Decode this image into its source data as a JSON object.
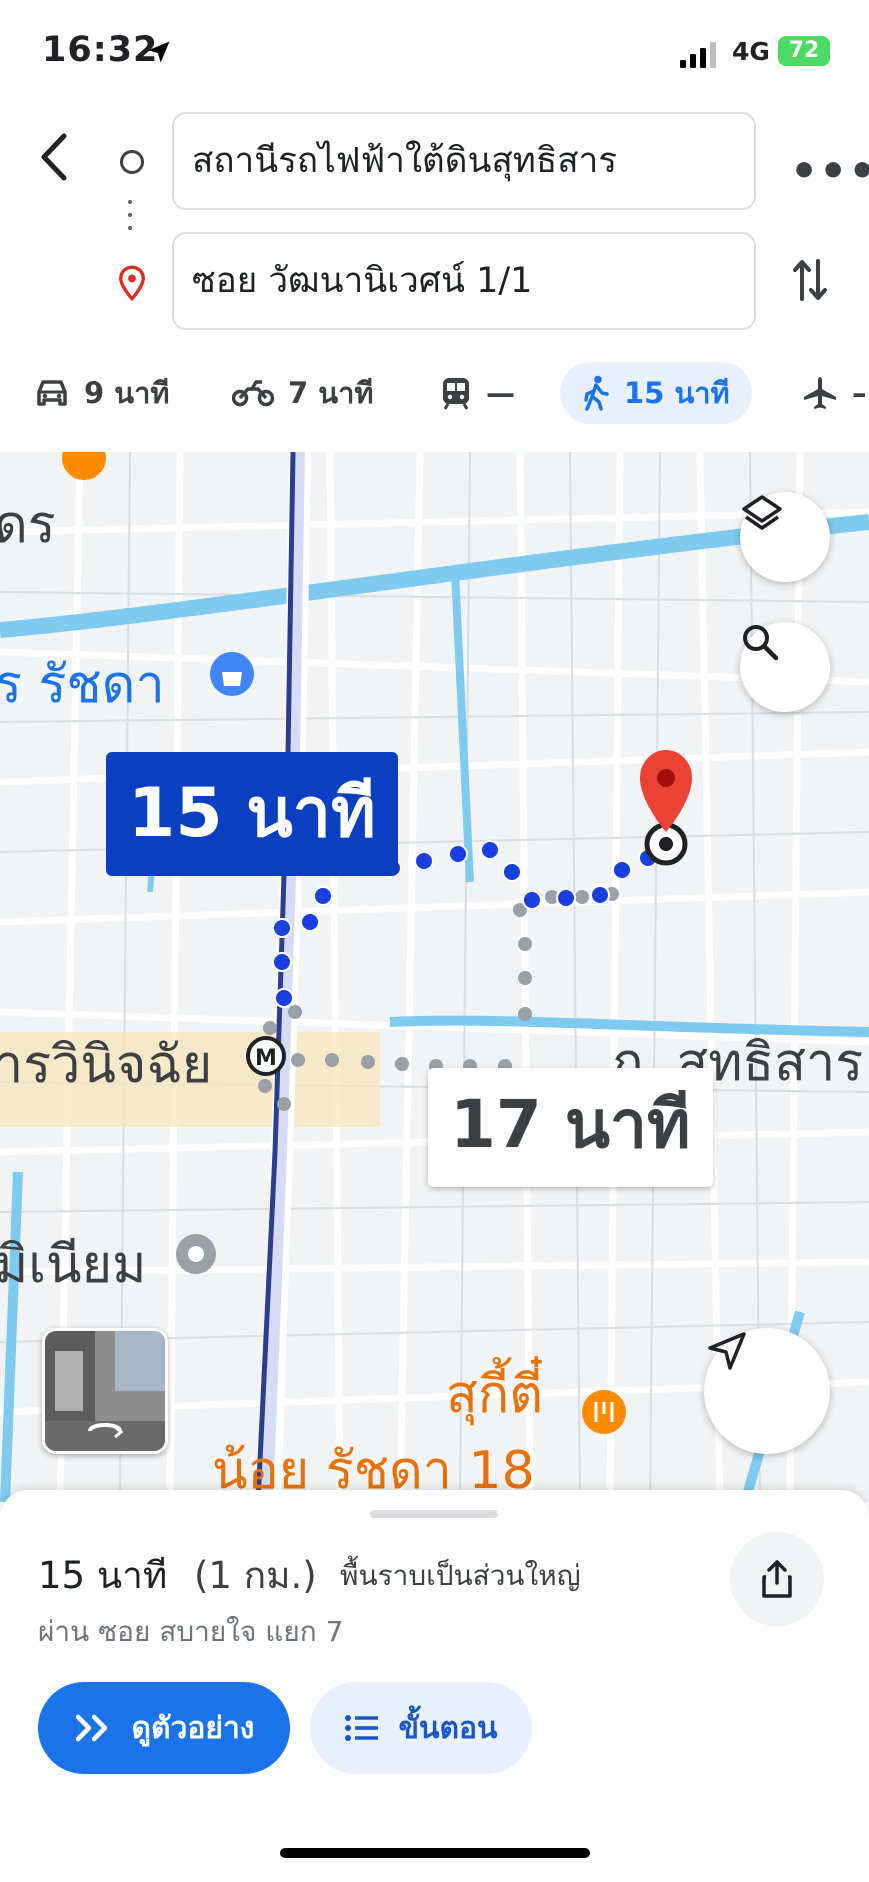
{
  "status_bar": {
    "time": "16:32",
    "network": "4G",
    "battery": "72"
  },
  "search": {
    "origin": "สถานีรถไฟฟ้าใต้ดินสุทธิสาร",
    "destination": "ซอย วัฒนานิเวศน์ 1/1",
    "more": "•••"
  },
  "modes": [
    {
      "icon": "car-icon",
      "label": "9 นาที"
    },
    {
      "icon": "motorcycle-icon",
      "label": "7 นาที"
    },
    {
      "icon": "transit-icon",
      "label": "—"
    },
    {
      "icon": "walk-icon",
      "label": "15 นาที",
      "active": true
    },
    {
      "icon": "flight-icon",
      "label": "–"
    }
  ],
  "map": {
    "labels": {
      "area_top_left": "ดร",
      "ratchada": "ร รัชดา",
      "station": "ารวินิจฉัย",
      "road": "ถ. สุทธิสาร",
      "millennium": "มิเนียม",
      "suki": "สุกี้ตี๋",
      "noi_ratchada": "น้อย รัชดา 18"
    },
    "route_primary_duration": "15 นาที",
    "route_alt_duration": "17 นาที",
    "colors": {
      "route": "#1a3fe0",
      "alt_route": "#9aa0a6",
      "pin": "#ea4335",
      "water": "#7ecbef"
    }
  },
  "summary": {
    "duration": "15 นาที",
    "distance": "(1 กม.)",
    "terrain": "พื้นราบเป็นส่วนใหญ่",
    "via": "ผ่าน ซอย สบายใจ แยก 7"
  },
  "buttons": {
    "preview": "ดูตัวอย่าง",
    "steps": "ขั้นตอน"
  }
}
